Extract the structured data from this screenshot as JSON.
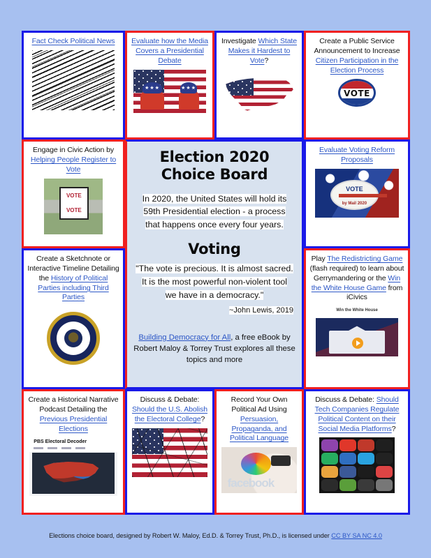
{
  "page": {
    "background_color": "#a7c0f0",
    "link_color": "#2b56c6",
    "border_blue": "#1a1ae8",
    "border_red": "#f02020",
    "center_panel_bg": "#d8e2ef"
  },
  "center": {
    "title_line1": "Election 2020",
    "title_line2": "Choice Board",
    "intro_line1": "In 2020, the United States will hold its",
    "intro_line2": "59th Presidential election - a process",
    "intro_line3": "that happens once every four years.",
    "section_heading": "Voting",
    "quote_line1": "\"The vote is precious. It is almost sacred.",
    "quote_line2": "It is the most powerful non-violent tool",
    "quote_line3": "we have in a democracy.\"",
    "attribution": "~John Lewis, 2019",
    "ebook_link": "Building Democracy for All",
    "ebook_rest": ", a free eBook by Robert Maloy & Torrey Trust explores all these topics and more"
  },
  "cells": {
    "fact_check": {
      "border": "blue",
      "text_parts": [
        {
          "text": "Fact Check Political News",
          "link": true
        }
      ],
      "image": "newsprint-word-cloud"
    },
    "media_debate": {
      "border": "red",
      "text_parts": [
        {
          "text": "Evaluate how the Media Covers a Presidential Debate",
          "link": true
        }
      ],
      "image": "elephant-donkey-flag"
    },
    "hardest_to_vote": {
      "border": "blue",
      "text_parts": [
        {
          "text": "Investigate ",
          "link": false
        },
        {
          "text": "Which State Makes it Hardest to Vote",
          "link": true
        },
        {
          "text": "?",
          "link": false
        }
      ],
      "image": "usa-flag-map"
    },
    "psa": {
      "border": "red",
      "text_parts": [
        {
          "text": "Create a Public Service Announcement to Increase ",
          "link": false
        },
        {
          "text": "Citizen Participation in the Election Process",
          "link": true
        }
      ],
      "image": "vote-button-badge"
    },
    "civic_action": {
      "border": "red",
      "text_parts": [
        {
          "text": "Engage in Civic Action by ",
          "link": false
        },
        {
          "text": "Helping People Register to Vote",
          "link": true
        }
      ],
      "image": "vote-here-yard-sign"
    },
    "voting_reform": {
      "border": "blue",
      "text_parts": [
        {
          "text": "Evaluate Voting Reform Proposals",
          "link": true
        }
      ],
      "image": "vote-by-mail-2020-pin"
    },
    "sketchnote": {
      "border": "blue",
      "text_parts": [
        {
          "text": "Create a Sketchnote or Interactive Timeline Detailing the ",
          "link": false
        },
        {
          "text": "History of Political Parties including Third Parties",
          "link": true
        }
      ],
      "image": "presidential-seal"
    },
    "redistricting": {
      "border": "red",
      "text_parts": [
        {
          "text": "Play ",
          "link": false
        },
        {
          "text": "The Redistricting Game",
          "link": true
        },
        {
          "text": " (flash required) to learn about Gerrymandering or the ",
          "link": false
        },
        {
          "text": "Win the White House Game",
          "link": true
        },
        {
          "text": " from iCivics",
          "link": false
        }
      ],
      "image": "win-the-white-house-game"
    },
    "podcast": {
      "border": "red",
      "text_parts": [
        {
          "text": "Create a Historical Narrative Podcast Detailing the ",
          "link": false
        },
        {
          "text": "Previous Presidential Elections",
          "link": true
        }
      ],
      "image": "pbs-electoral-decoder"
    },
    "electoral_college": {
      "border": "blue",
      "text_parts": [
        {
          "text": "Discuss & Debate: ",
          "link": false
        },
        {
          "text": "Should the U.S. Abolish the Electoral College",
          "link": true
        },
        {
          "text": "?",
          "link": false
        }
      ],
      "image": "cracked-american-flag"
    },
    "political_ad": {
      "border": "red",
      "text_parts": [
        {
          "text": "Record Your Own Political Ad Using ",
          "link": false
        },
        {
          "text": "Persuasion, Propaganda, and Political Language",
          "link": true
        }
      ],
      "image": "propaganda-collage"
    },
    "tech_companies": {
      "border": "blue",
      "text_parts": [
        {
          "text": "Discuss & Debate: ",
          "link": false
        },
        {
          "text": "Should Tech Companies Regulate Political Content on their Social Media Platforms",
          "link": true
        },
        {
          "text": "?",
          "link": false
        }
      ],
      "image": "social-media-app-icons"
    }
  },
  "footer": {
    "text": "Elections choice board, designed by Robert W. Maloy, Ed.D. & Torrey Trust, Ph.D., is licensed under ",
    "license_link": "CC BY SA NC 4.0"
  }
}
